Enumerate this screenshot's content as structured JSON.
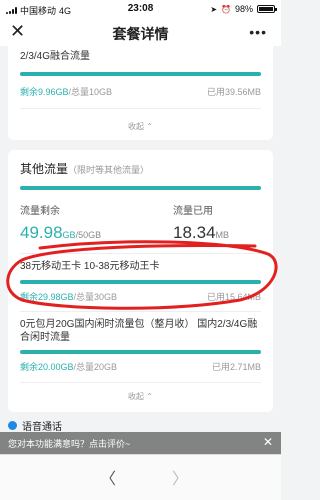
{
  "status": {
    "carrier": "中国移动",
    "network": "4G",
    "time": "23:08",
    "battery": "98%",
    "battery_level": 0.98
  },
  "nav": {
    "title": "套餐详情",
    "close": "✕",
    "more": "•••"
  },
  "top_card": {
    "pkg_name": "2/3/4G融合流量",
    "remain": "剩余9.96GB",
    "total": "/总量10GB",
    "used": "已用39.56MB",
    "used_fraction": 0.996,
    "collapse": "收起 ⌃"
  },
  "other": {
    "title": "其他流量",
    "subtitle": "（限时等其他流量）",
    "remain_label": "流量剩余",
    "remain_value": "49.98",
    "remain_unit": "GB",
    "remain_total": "/50GB",
    "used_label": "流量已用",
    "used_value": "18.34",
    "used_unit": "MB",
    "fraction": 0.9996,
    "packages": [
      {
        "name": "38元移动王卡 10-38元移动王卡",
        "remain": "剩余29.98GB",
        "total": "/总量30GB",
        "used": "已用15.64MB",
        "fraction": 0.999
      },
      {
        "name": "0元包月20G国内闲时流量包（整月收） 国内2/3/4G融合闲时流量",
        "remain": "剩余20.00GB",
        "total": "/总量20GB",
        "used": "已用2.71MB",
        "fraction": 1.0
      }
    ],
    "collapse": "收起 ⌃"
  },
  "voice": {
    "label": "语音通话"
  },
  "banner": {
    "text": "您对本功能满意吗？点击评价~",
    "close": "✕"
  },
  "bottom": {
    "back": "〈",
    "forward": "〉"
  },
  "colors": {
    "accent": "#2ab1ae",
    "annotation": "#e32020"
  }
}
